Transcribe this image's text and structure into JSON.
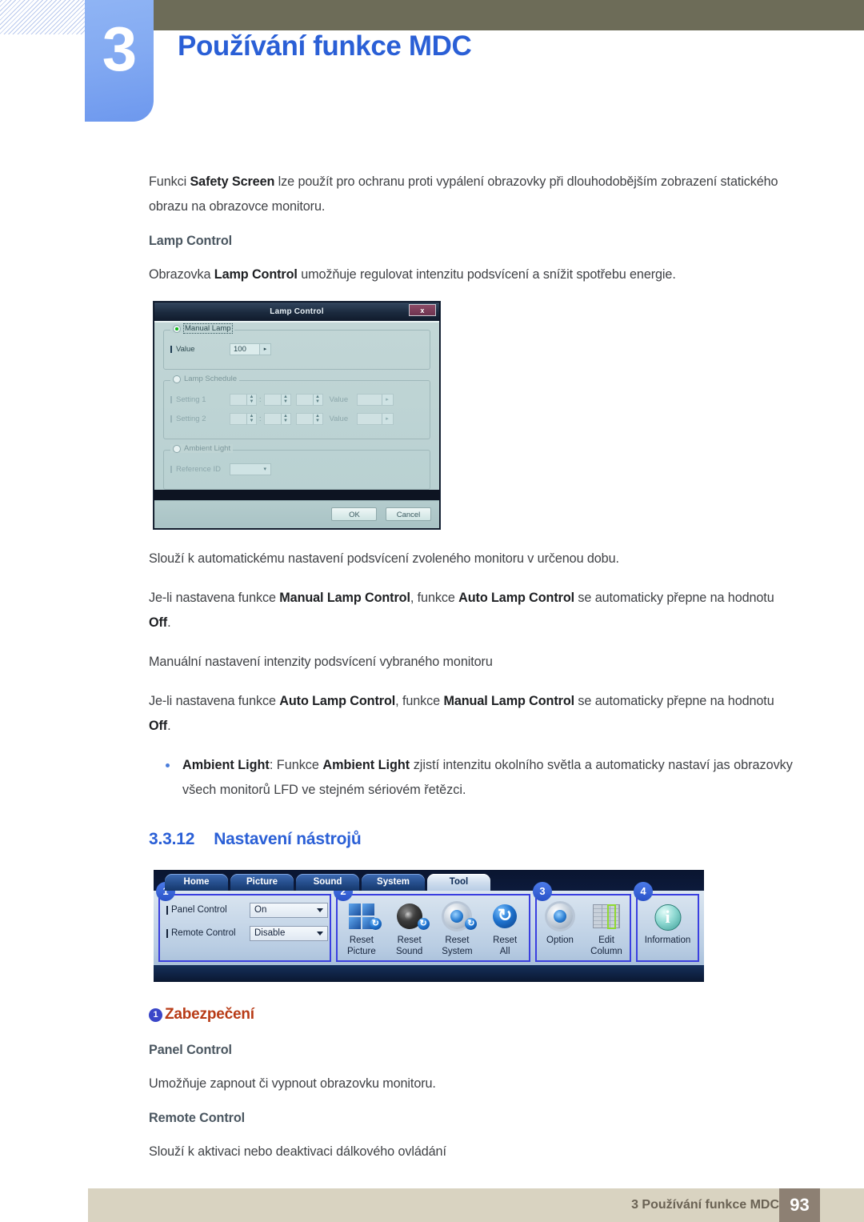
{
  "header": {
    "chapter_number": "3",
    "chapter_title": "Používání funkce MDC"
  },
  "content": {
    "intro_paragraph_pre": "Funkci ",
    "intro_bold": "Safety Screen",
    "intro_paragraph_post": " lze použít pro ochranu proti vypálení obrazovky při dlouhodobějším zobrazení statického obrazu na obrazovce monitoru.",
    "lamp_control_heading": "Lamp Control",
    "lamp_control_pre": "Obrazovka ",
    "lamp_control_bold": "Lamp Control",
    "lamp_control_post": " umožňuje regulovat intenzitu podsvícení a snížit spotřebu energie.",
    "after_dialog_paragraph": "Slouží k automatickému nastavení podsvícení zvoleného monitoru v určenou dobu.",
    "manual_auto_pre": "Je-li nastavena funkce ",
    "manual_auto_b1": "Manual Lamp Control",
    "manual_auto_mid": ", funkce ",
    "manual_auto_b2": "Auto Lamp Control",
    "manual_auto_post": " se automaticky přepne na hodnotu ",
    "manual_auto_b3": "Off",
    "manual_auto_end": ".",
    "manual_note": "Manuální nastavení intenzity podsvícení vybraného monitoru",
    "auto_manual_pre": "Je-li nastavena funkce ",
    "auto_manual_b1": "Auto Lamp Control",
    "auto_manual_mid": ", funkce ",
    "auto_manual_b2": "Manual Lamp Control",
    "auto_manual_post": " se automaticky přepne na hodnotu ",
    "auto_manual_b3": "Off",
    "auto_manual_end": ".",
    "ambient_bullet_b1": "Ambient Light",
    "ambient_bullet_mid": ": Funkce ",
    "ambient_bullet_b2": "Ambient Light",
    "ambient_bullet_post": " zjistí intenzitu okolního světla a automaticky nastaví jas obrazovky všech monitorů LFD ve stejném sériovém řetězci.",
    "section_number": "3.3.12",
    "section_title": "Nastavení nástrojů",
    "security_badge": "1",
    "security_heading": "Zabezpečení",
    "panel_control_heading": "Panel Control",
    "panel_control_text": "Umožňuje zapnout či vypnout obrazovku monitoru.",
    "remote_control_heading": "Remote Control",
    "remote_control_text": "Slouží k aktivaci nebo deaktivaci dálkového ovládání"
  },
  "lamp_dialog": {
    "title": "Lamp Control",
    "close_label": "x",
    "manual_lamp_legend": "Manual Lamp",
    "value_label": "Value",
    "value_amount": "100",
    "value_arrow": "▸",
    "lamp_schedule_legend": "Lamp Schedule",
    "setting1_label": "Setting 1",
    "setting2_label": "Setting 2",
    "schedule_value_label": "Value",
    "schedule_value_arrow": "▸",
    "colon": ":",
    "ambient_light_legend": "Ambient Light",
    "reference_id_label": "Reference ID",
    "reference_id_value": "",
    "ok_label": "OK",
    "cancel_label": "Cancel"
  },
  "tool_toolbar": {
    "tabs": [
      {
        "label": "Home",
        "active": false
      },
      {
        "label": "Picture",
        "active": false
      },
      {
        "label": "Sound",
        "active": false
      },
      {
        "label": "System",
        "active": false
      },
      {
        "label": "Tool",
        "active": true
      }
    ],
    "group1": {
      "number": "1",
      "panel_control_label": "Panel Control",
      "panel_control_value": "On",
      "remote_control_label": "Remote Control",
      "remote_control_value": "Disable"
    },
    "group2": {
      "number": "2",
      "items": [
        {
          "line1": "Reset",
          "line2": "Picture",
          "icon": "reset-picture-icon"
        },
        {
          "line1": "Reset",
          "line2": "Sound",
          "icon": "reset-sound-icon"
        },
        {
          "line1": "Reset",
          "line2": "System",
          "icon": "reset-system-icon"
        },
        {
          "line1": "Reset",
          "line2": "All",
          "icon": "reset-all-icon"
        }
      ]
    },
    "group3": {
      "number": "3",
      "items": [
        {
          "line1": "Option",
          "line2": "",
          "icon": "option-gear-icon"
        },
        {
          "line1": "Edit",
          "line2": "Column",
          "icon": "edit-column-icon"
        }
      ]
    },
    "group4": {
      "number": "4",
      "items": [
        {
          "line1": "Information",
          "line2": "",
          "icon": "information-icon"
        }
      ]
    }
  },
  "footer": {
    "text": "3 Používání funkce MDC",
    "page_number": "93"
  },
  "colors": {
    "accent_blue": "#2a5fd6",
    "olive_bar": "#6d6c58",
    "footer_bar": "#d9d3c1",
    "page_num_box": "#8d8073",
    "heading_rust": "#b83b16",
    "badge_blue": "#3a46c8",
    "group_outline": "#3a3fe0"
  }
}
